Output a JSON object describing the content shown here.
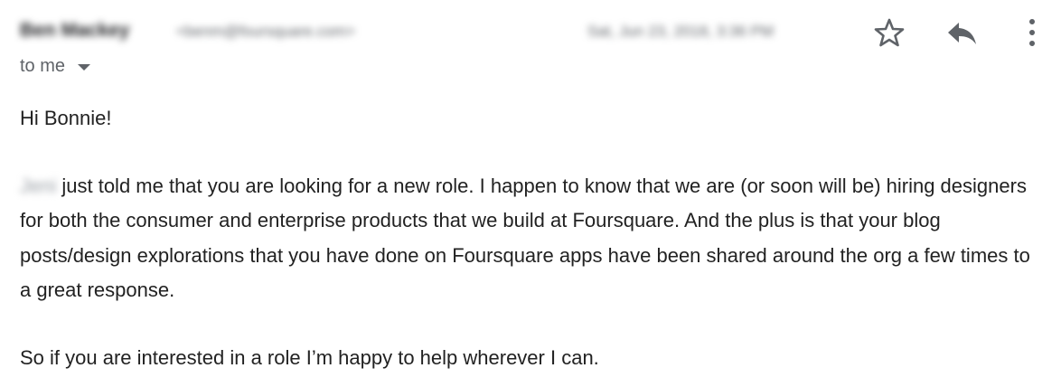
{
  "header": {
    "sender_name": "Ben Mackey",
    "sender_email": "<benm@foursquare.com>",
    "date": "Sat, Jun 23, 2018, 3:36 PM",
    "recipient_label": "to me"
  },
  "icons": {
    "star": "star-outline-icon",
    "reply": "reply-arrow-icon",
    "more": "vertical-dots-icon",
    "dropdown": "caret-down-icon"
  },
  "message": {
    "greeting": "Hi Bonnie!",
    "referrer_name": "Jeni",
    "paragraph1_text": "just told me that you are looking for a new role. I happen to know that we are (or soon will be) hiring designers for both the consumer and enterprise products that we build at Foursquare. And the plus is that your blog posts/design explorations that you have done on Foursquare apps have been shared around the org a few times to a great response.",
    "paragraph2_text": "So if you are interested in a role I’m happy to help wherever I can."
  }
}
